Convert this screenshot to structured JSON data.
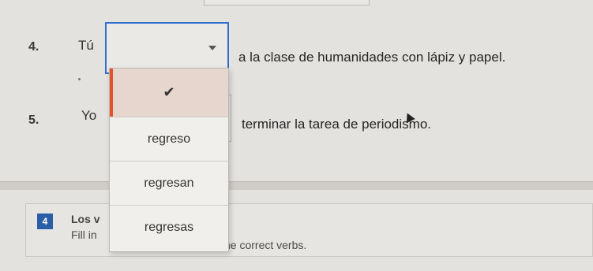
{
  "items": [
    {
      "number": "4.",
      "subject": "Tú",
      "rest": "a la clase de humanidades con lápiz y papel."
    },
    {
      "number": "5.",
      "subject": "Yo",
      "rest": "terminar la tarea de periodismo."
    }
  ],
  "dropdown": {
    "selected_icon": "checkmark-icon",
    "selected_glyph": "✔",
    "options": [
      "regreso",
      "regresan",
      "regresas"
    ]
  },
  "next_section": {
    "badge": "4",
    "title": "Los v",
    "instruction_start": "Fill in",
    "instruction_end": "he correct verbs."
  },
  "colors": {
    "focus_border": "#2f6fce",
    "selected_accent": "#e1542b",
    "badge": "#2a5fa8"
  }
}
